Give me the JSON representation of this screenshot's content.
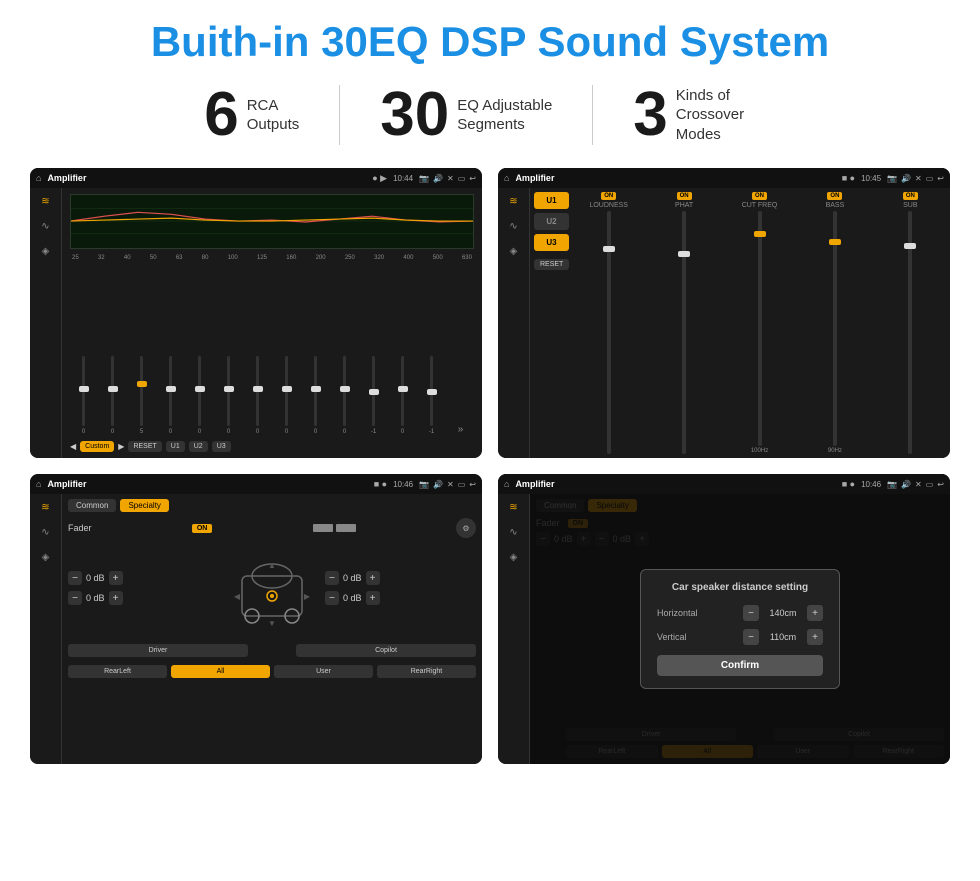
{
  "title": "Buith-in 30EQ DSP Sound System",
  "stats": [
    {
      "number": "6",
      "label": "RCA\nOutputs"
    },
    {
      "number": "30",
      "label": "EQ Adjustable\nSegments"
    },
    {
      "number": "3",
      "label": "Kinds of\nCrossover Modes"
    }
  ],
  "screen1": {
    "topbar": {
      "title": "Amplifier",
      "time": "10:44"
    },
    "freqLabels": [
      "25",
      "32",
      "40",
      "50",
      "63",
      "80",
      "100",
      "125",
      "160",
      "200",
      "250",
      "320",
      "400",
      "500",
      "630"
    ],
    "sliderValues": [
      "0",
      "0",
      "0",
      "5",
      "0",
      "0",
      "0",
      "0",
      "0",
      "0",
      "0",
      "-1",
      "0",
      "-1"
    ],
    "bottomBtns": [
      "Custom",
      "RESET",
      "U1",
      "U2",
      "U3"
    ]
  },
  "screen2": {
    "topbar": {
      "title": "Amplifier",
      "time": "10:45"
    },
    "uButtons": [
      "U1",
      "U2",
      "U3"
    ],
    "channels": [
      {
        "name": "LOUDNESS",
        "on": true
      },
      {
        "name": "PHAT",
        "on": true
      },
      {
        "name": "CUT FREQ",
        "on": true
      },
      {
        "name": "BASS",
        "on": true
      },
      {
        "name": "SUB",
        "on": true
      }
    ],
    "resetLabel": "RESET"
  },
  "screen3": {
    "topbar": {
      "title": "Amplifier",
      "time": "10:46"
    },
    "tabs": [
      "Common",
      "Specialty"
    ],
    "faderLabel": "Fader",
    "faderOn": "ON",
    "dbValues": [
      "0 dB",
      "0 dB",
      "0 dB",
      "0 dB"
    ],
    "bottomBtns": [
      "Driver",
      "",
      "Copilot",
      "RearLeft",
      "All",
      "User",
      "RearRight"
    ]
  },
  "screen4": {
    "topbar": {
      "title": "Amplifier",
      "time": "10:46"
    },
    "tabs": [
      "Common",
      "Specialty"
    ],
    "dialog": {
      "title": "Car speaker distance setting",
      "rows": [
        {
          "label": "Horizontal",
          "value": "140cm"
        },
        {
          "label": "Vertical",
          "value": "110cm"
        }
      ],
      "confirmLabel": "Confirm"
    },
    "dbValues": [
      "0 dB",
      "0 dB"
    ],
    "bottomBtns": [
      "Driver",
      "Copilot",
      "RearLeft",
      "All",
      "User",
      "RearRight"
    ]
  },
  "icons": {
    "home": "⌂",
    "eq": "≋",
    "wave": "∿",
    "speaker": "◈",
    "location": "📍",
    "camera": "📷",
    "volume": "🔊",
    "back": "↩",
    "settings": "⚙",
    "minus": "−",
    "plus": "+"
  }
}
